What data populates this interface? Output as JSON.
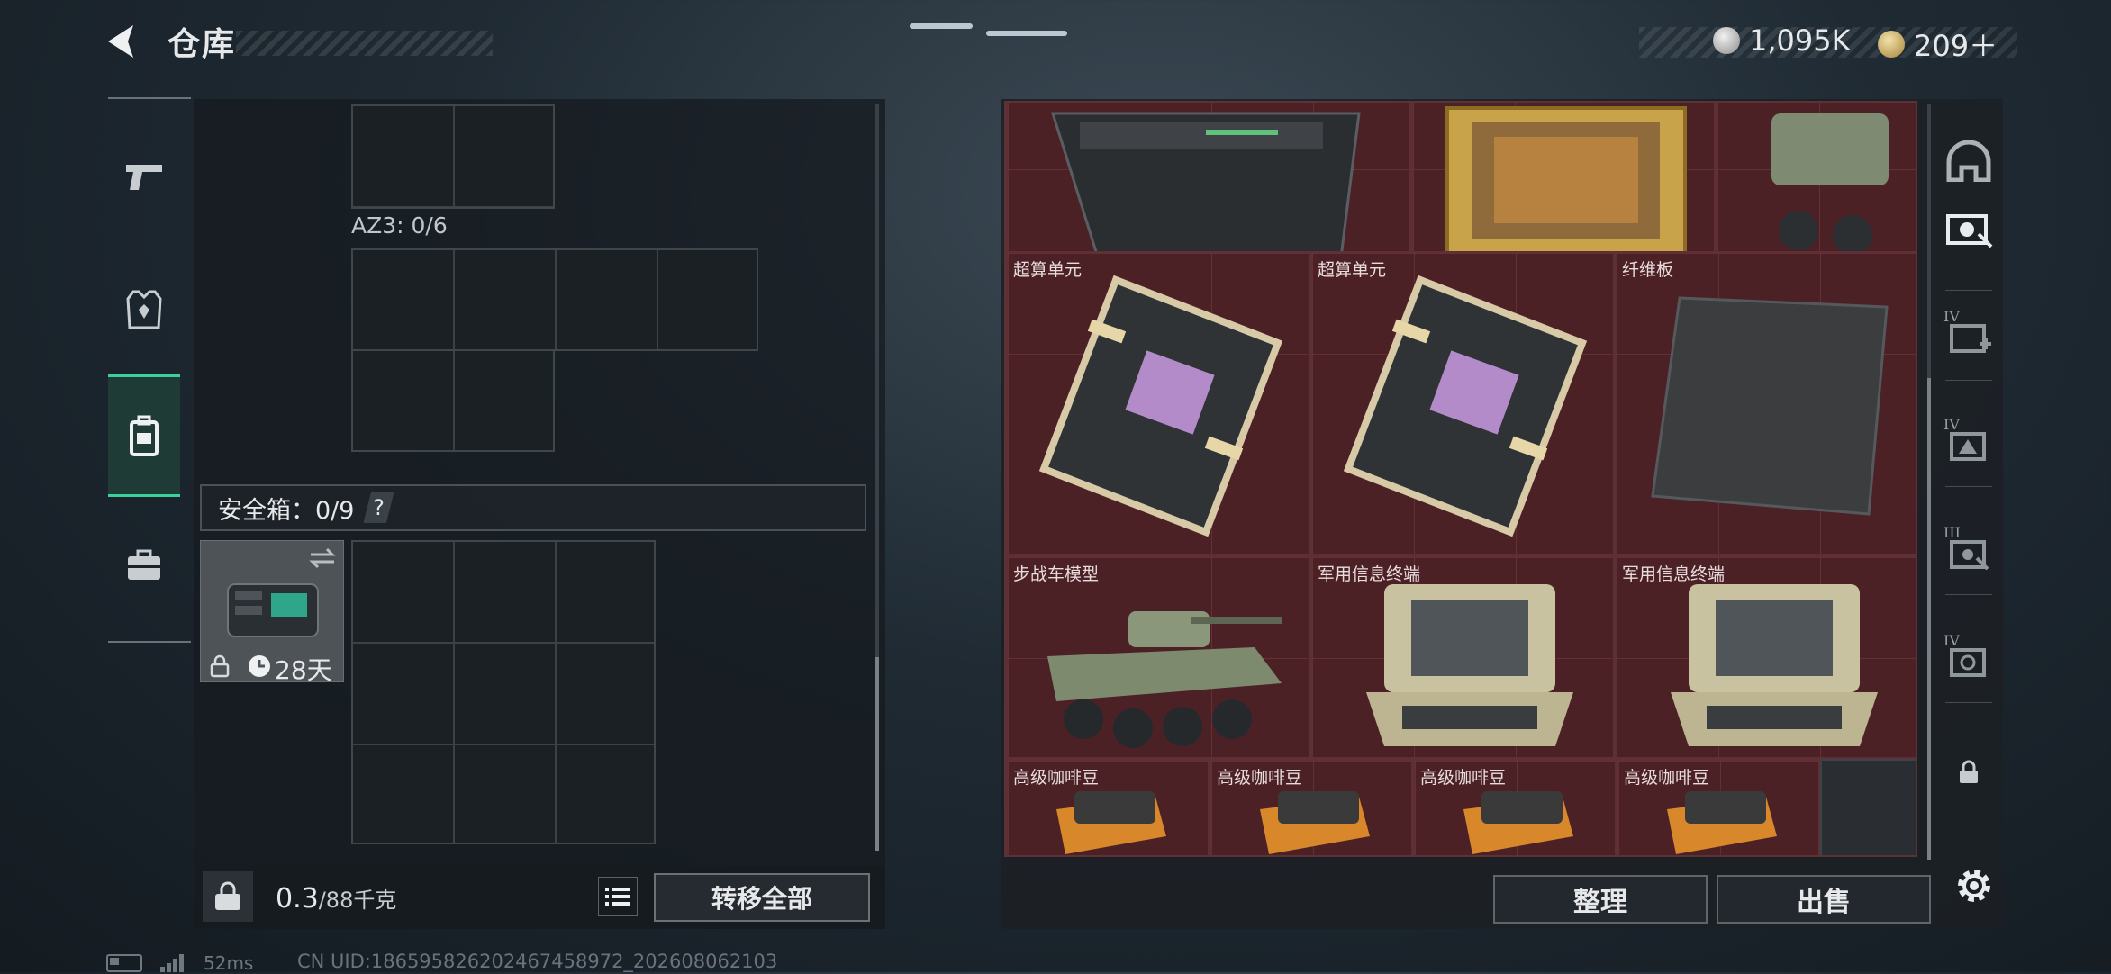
{
  "header": {
    "title": "仓库",
    "currency_silver": "1,095K",
    "currency_gold": "209＋"
  },
  "nav": [
    {
      "id": "weapons",
      "icon": "pistol-icon"
    },
    {
      "id": "armor",
      "icon": "armor-vest-icon"
    },
    {
      "id": "backpack",
      "icon": "backpack-icon",
      "active": true
    },
    {
      "id": "case",
      "icon": "briefcase-icon"
    }
  ],
  "loadout": {
    "az3_label": "AZ3: 0/6",
    "safebox_label": "安全箱：0/9",
    "safebox_help": "?",
    "safebox_item_timer": "28天",
    "weight_value": "0.3",
    "weight_max": "/88千克",
    "transfer_all": "转移全部"
  },
  "stash": {
    "items": [
      {
        "label": "超算单元",
        "icon": "supercomputer-unit-icon"
      },
      {
        "label": "超算单元",
        "icon": "supercomputer-unit-icon"
      },
      {
        "label": "纤维板",
        "icon": "fiberboard-icon"
      },
      {
        "label": "步战车模型",
        "icon": "ifv-model-icon"
      },
      {
        "label": "军用信息终端",
        "icon": "military-terminal-icon"
      },
      {
        "label": "军用信息终端",
        "icon": "military-terminal-icon"
      },
      {
        "label": "高级咖啡豆",
        "icon": "coffee-beans-icon"
      },
      {
        "label": "高级咖啡豆",
        "icon": "coffee-beans-icon"
      },
      {
        "label": "高级咖啡豆",
        "icon": "coffee-beans-icon"
      },
      {
        "label": "高级咖啡豆",
        "icon": "coffee-beans-icon"
      }
    ],
    "top_row_icons": [
      "server-unit-icon",
      "framed-painting-icon",
      "vehicle-model-icon"
    ]
  },
  "tools": [
    {
      "icon": "helmet-icon"
    },
    {
      "icon": "camera-select-icon"
    },
    {
      "tier": "IV",
      "icon": "camera-add-icon"
    },
    {
      "tier": "IV",
      "icon": "camera-warning-icon"
    },
    {
      "tier": "III",
      "icon": "camera-cursor-icon"
    },
    {
      "tier": "IV",
      "icon": "camera-filter-icon"
    },
    {
      "icon": "lock-icon"
    }
  ],
  "actions": {
    "organize": "整理",
    "sell": "出售"
  },
  "status": {
    "ping": "52ms",
    "uid": "CN UID:1865958262024674589​72_202608062103"
  },
  "colors": {
    "accent_green": "#3ad29a",
    "stash_red": "#4b2126"
  }
}
